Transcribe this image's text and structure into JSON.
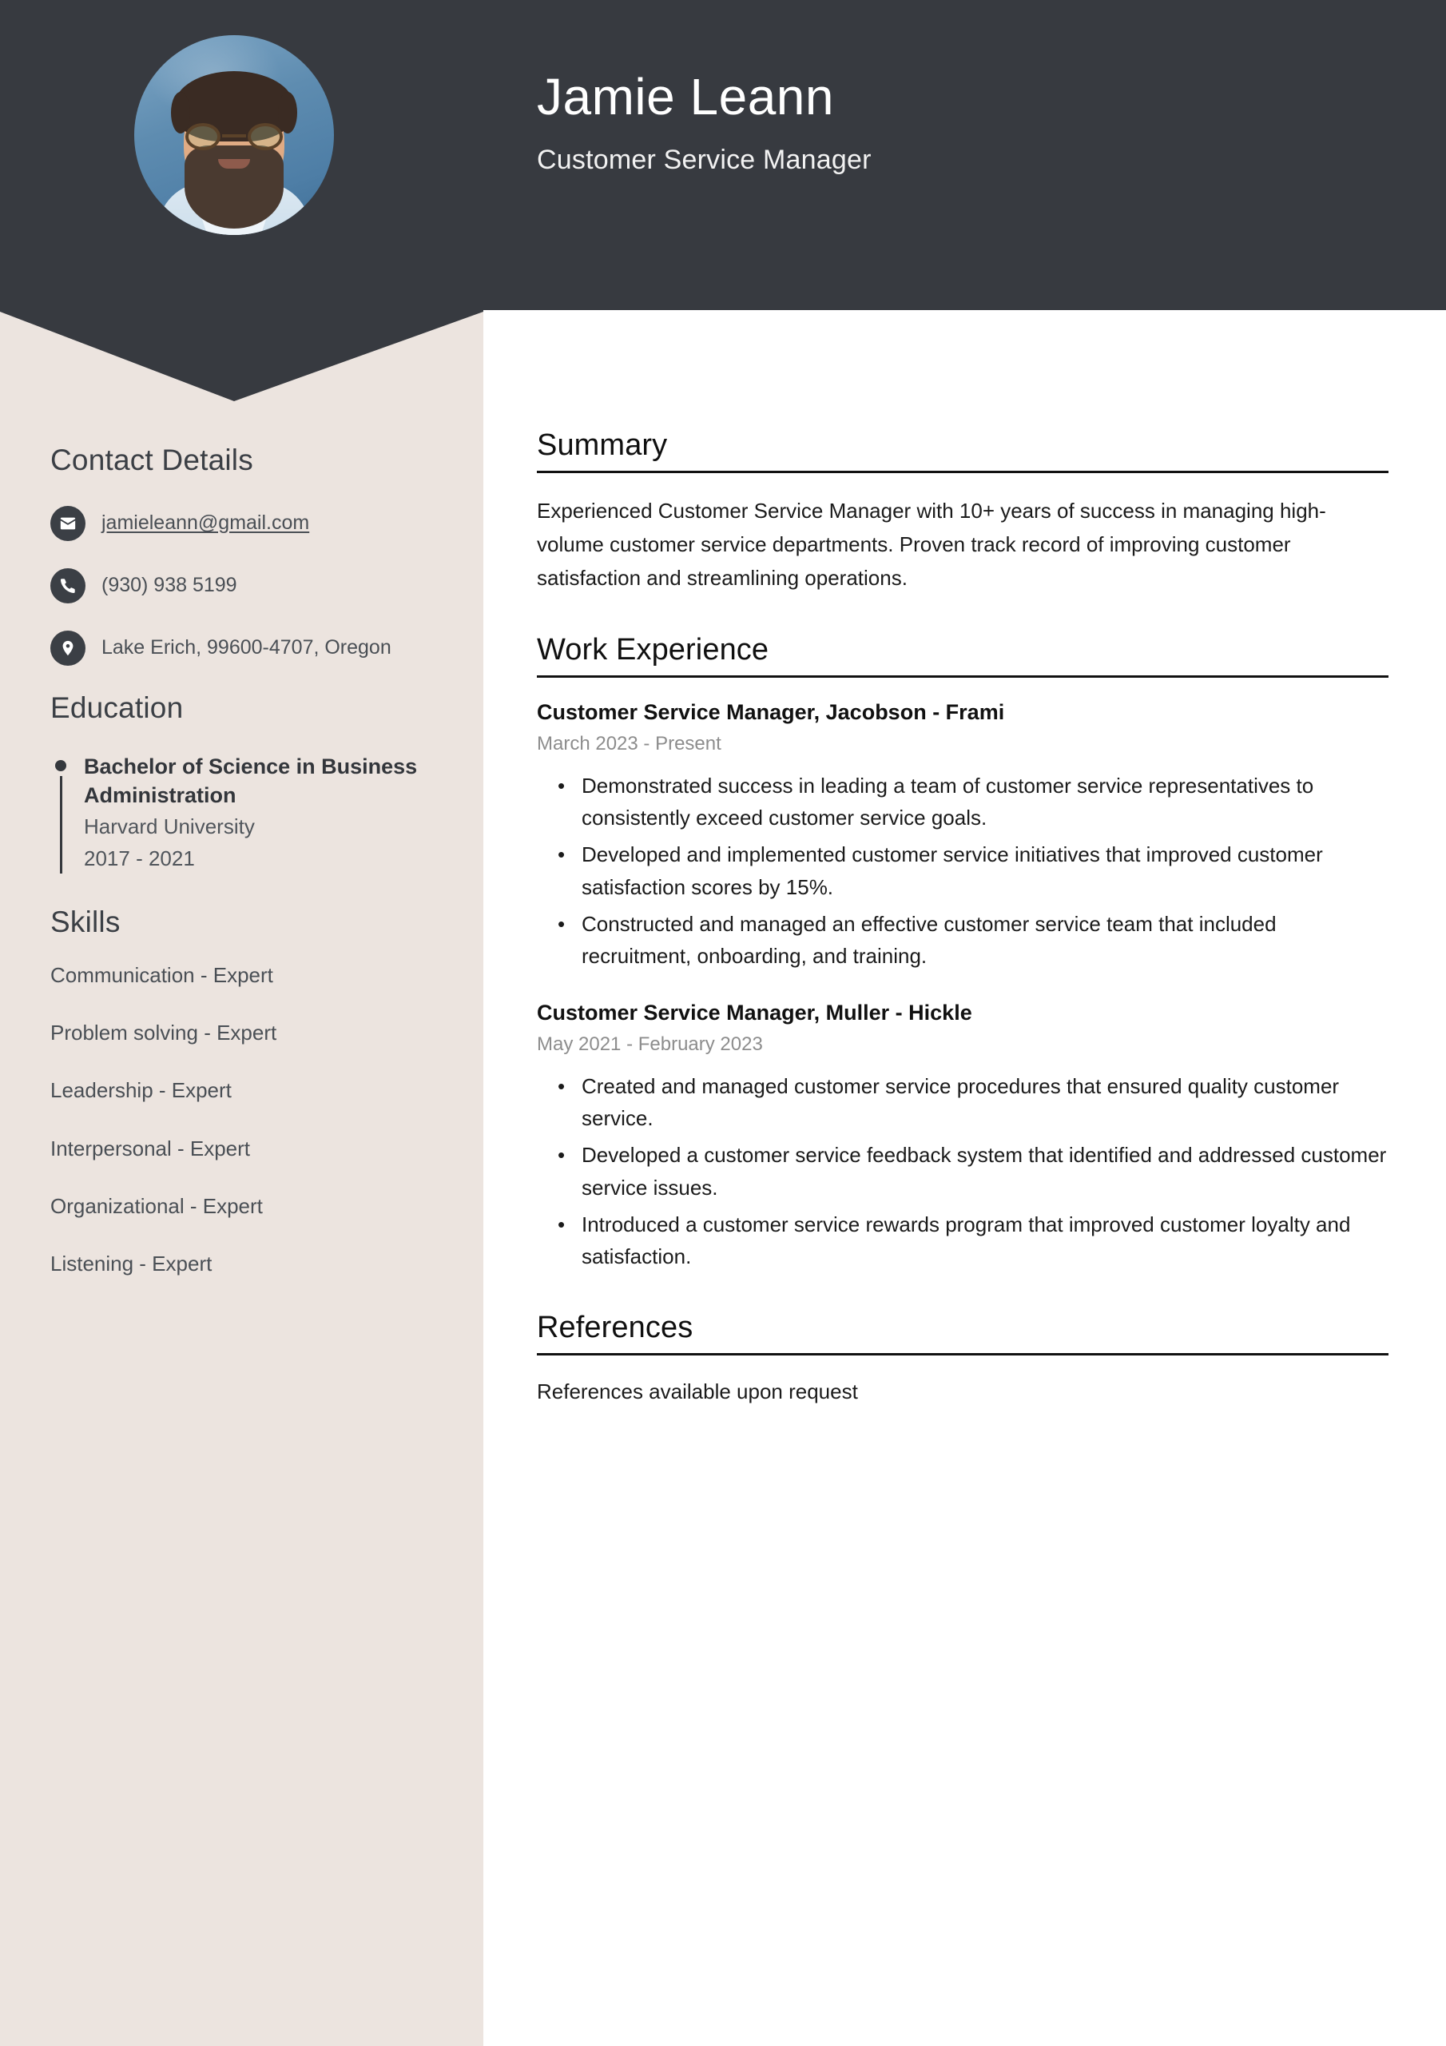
{
  "theme": {
    "header_bg": "#373a40",
    "sidebar_bg": "#ece4df",
    "main_bg": "#ffffff",
    "accent_text": "#111111",
    "muted_text": "#8d8d8d"
  },
  "header": {
    "name": "Jamie Leann",
    "job_title": "Customer Service Manager",
    "avatar_alt": "profile-photo"
  },
  "sidebar": {
    "contact": {
      "heading": "Contact Details",
      "items": [
        {
          "icon": "envelope-icon",
          "value": "jamieleann@gmail.com",
          "is_link": true
        },
        {
          "icon": "phone-icon",
          "value": "(930) 938 5199",
          "is_link": false
        },
        {
          "icon": "location-pin-icon",
          "value": "Lake Erich, 99600-4707, Oregon",
          "is_link": false
        }
      ]
    },
    "education": {
      "heading": "Education",
      "entries": [
        {
          "degree": "Bachelor of Science in Business Administration",
          "school": "Harvard University",
          "dates": "2017 - 2021"
        }
      ]
    },
    "skills": {
      "heading": "Skills",
      "items": [
        "Communication - Expert",
        "Problem solving - Expert",
        "Leadership - Expert",
        "Interpersonal - Expert",
        "Organizational - Expert",
        "Listening - Expert"
      ]
    }
  },
  "main": {
    "summary": {
      "heading": "Summary",
      "text": "Experienced Customer Service Manager with 10+ years of success in managing high-volume customer service departments. Proven track record of improving customer satisfaction and streamlining operations."
    },
    "work_experience": {
      "heading": "Work Experience",
      "jobs": [
        {
          "title": "Customer Service Manager, Jacobson - Frami",
          "dates": "March 2023 - Present",
          "bullets": [
            "Demonstrated success in leading a team of customer service representatives to consistently exceed customer service goals.",
            "Developed and implemented customer service initiatives that improved customer satisfaction scores by 15%.",
            "Constructed and managed an effective customer service team that included recruitment, onboarding, and training."
          ]
        },
        {
          "title": "Customer Service Manager, Muller - Hickle",
          "dates": "May 2021 - February 2023",
          "bullets": [
            "Created and managed customer service procedures that ensured quality customer service.",
            "Developed a customer service feedback system that identified and addressed customer service issues.",
            "Introduced a customer service rewards program that improved customer loyalty and satisfaction."
          ]
        }
      ]
    },
    "references": {
      "heading": "References",
      "text": "References available upon request"
    }
  }
}
